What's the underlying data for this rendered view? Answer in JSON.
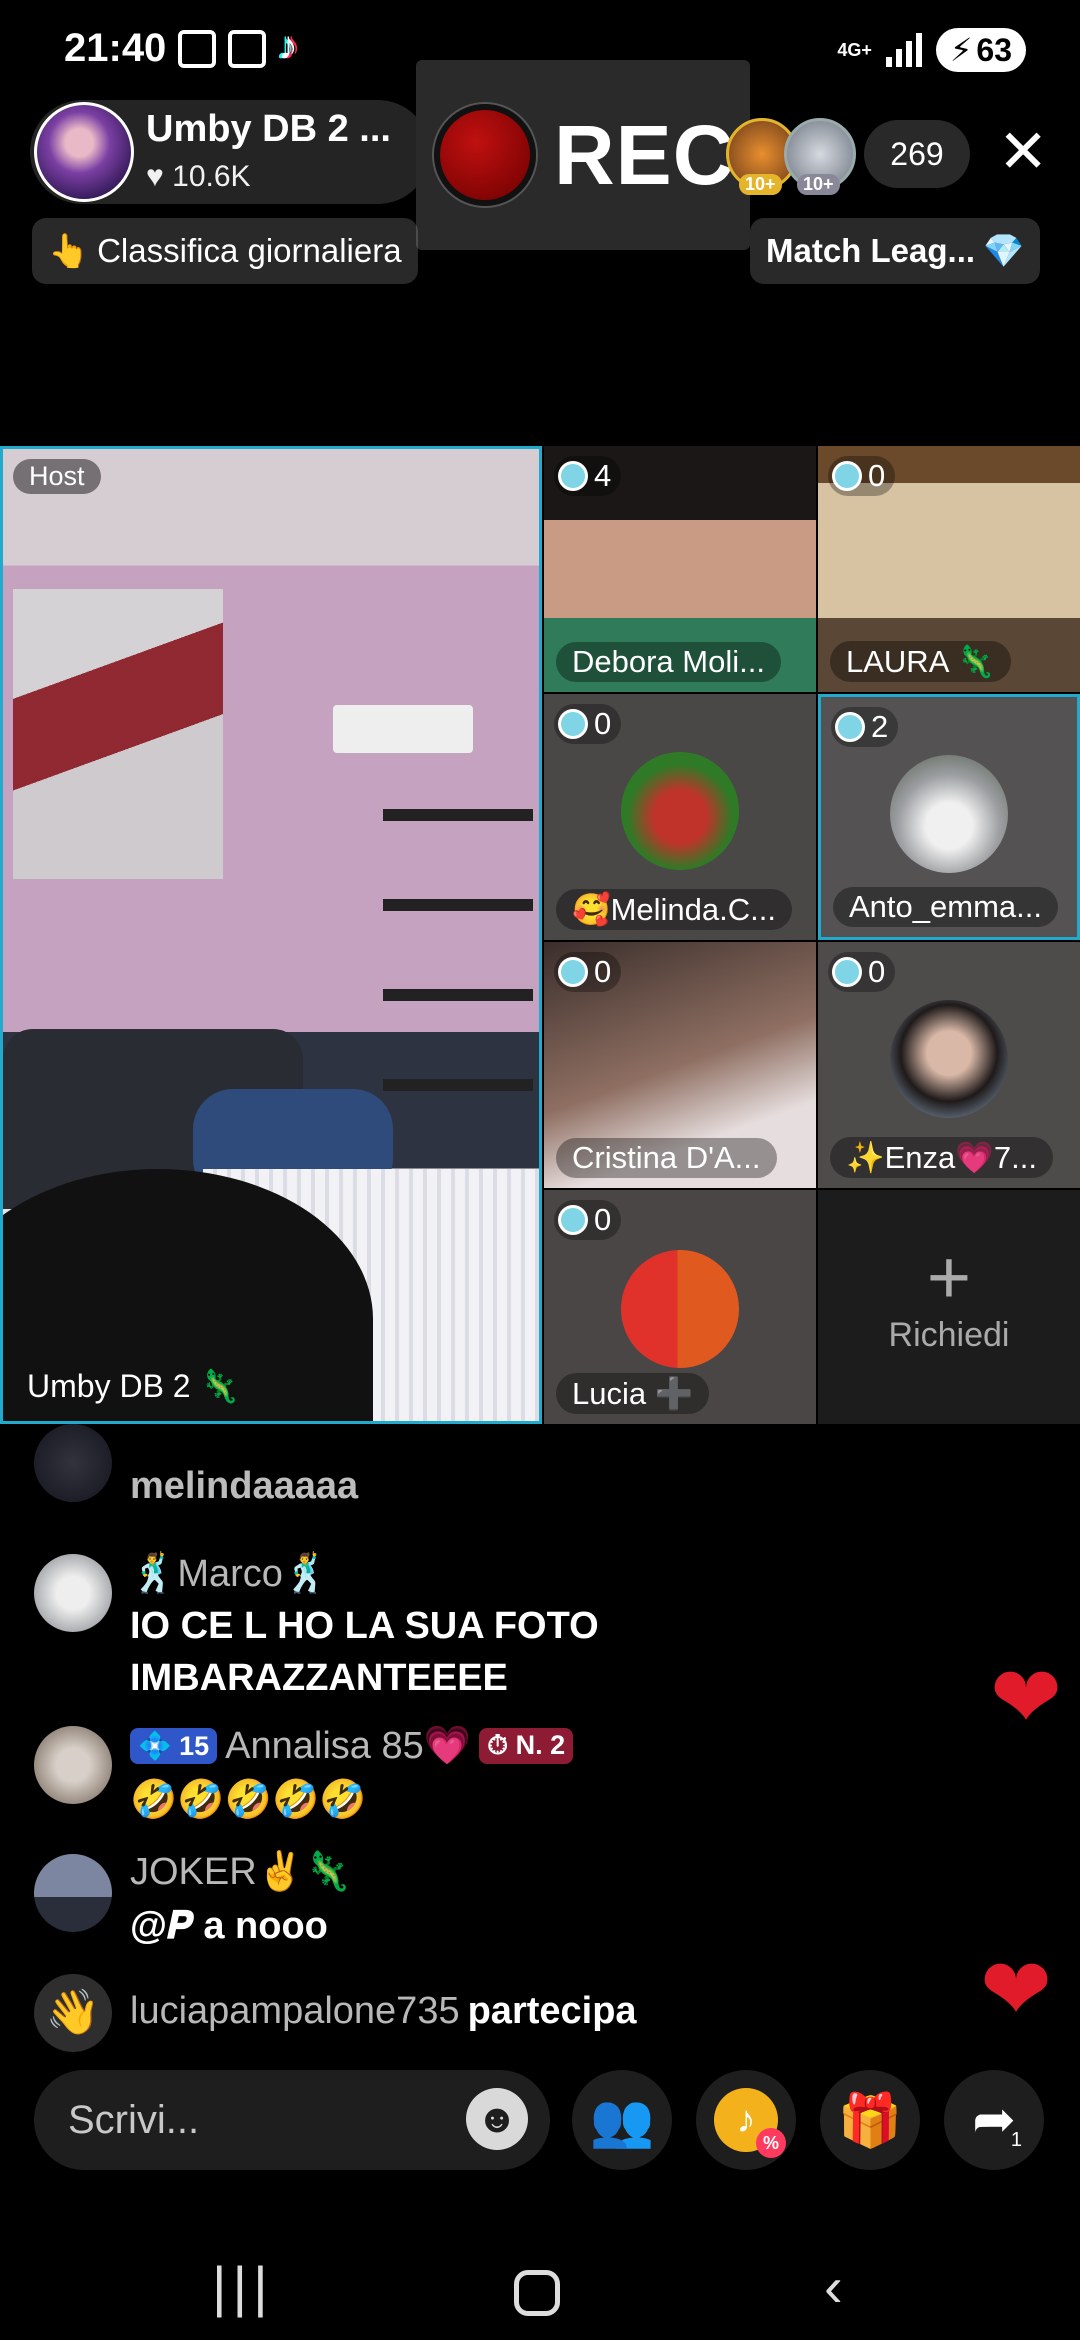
{
  "status_bar": {
    "time": "21:40",
    "network": "4G+",
    "battery": "63",
    "icons": [
      "screen-capture-icon",
      "screen-capture-icon",
      "tiktok-icon",
      "signal-icon",
      "battery-charging-icon"
    ]
  },
  "header": {
    "host_name": "Umby DB 2 ...",
    "likes": "10.6K",
    "rec_label": "REC",
    "viewer_badges": [
      "10+",
      "10+"
    ],
    "viewer_count": "269",
    "close_icon": "close-icon"
  },
  "chips": {
    "ranking": "Classifica giornaliera",
    "ranking_emoji": "👆",
    "match": "Match Leag...",
    "match_emoji": "💎"
  },
  "grid": {
    "host_tag": "Host",
    "host_label": "Umby DB 2 🦎",
    "guests": [
      {
        "name": "Debora Moli...",
        "score": "4"
      },
      {
        "name": "LAURA 🦎",
        "score": "0"
      },
      {
        "name": "🥰Melinda.C...",
        "score": "0"
      },
      {
        "name": "Anto_emma...",
        "score": "2"
      },
      {
        "name": "Cristina D'A...",
        "score": "0"
      },
      {
        "name": "✨Enza💗7...",
        "score": "0"
      },
      {
        "name": "Lucia ➕",
        "score": "0"
      }
    ],
    "request": {
      "plus": "+",
      "label": "Richiedi"
    }
  },
  "chat": [
    {
      "user": "",
      "text": "melindaaaaa"
    },
    {
      "user": "🕺Marco🕺",
      "text": "IO CE L HO LA SUA FOTO IMBARAZZANTEEEE"
    },
    {
      "user": "Annalisa 85💗",
      "level": "15",
      "rank": "N. 2",
      "text": "🤣🤣🤣🤣🤣"
    },
    {
      "user": "JOKER✌️🦎",
      "text": "@𝑷 a nooo"
    },
    {
      "user": "luciapampalone735",
      "text": "partecipa"
    }
  ],
  "composer": {
    "placeholder": "Scrivi...",
    "share_count": "1"
  },
  "colors": {
    "accent_blue": "#22aacc",
    "heart": "#e21b2b",
    "rec": "#c01010"
  }
}
